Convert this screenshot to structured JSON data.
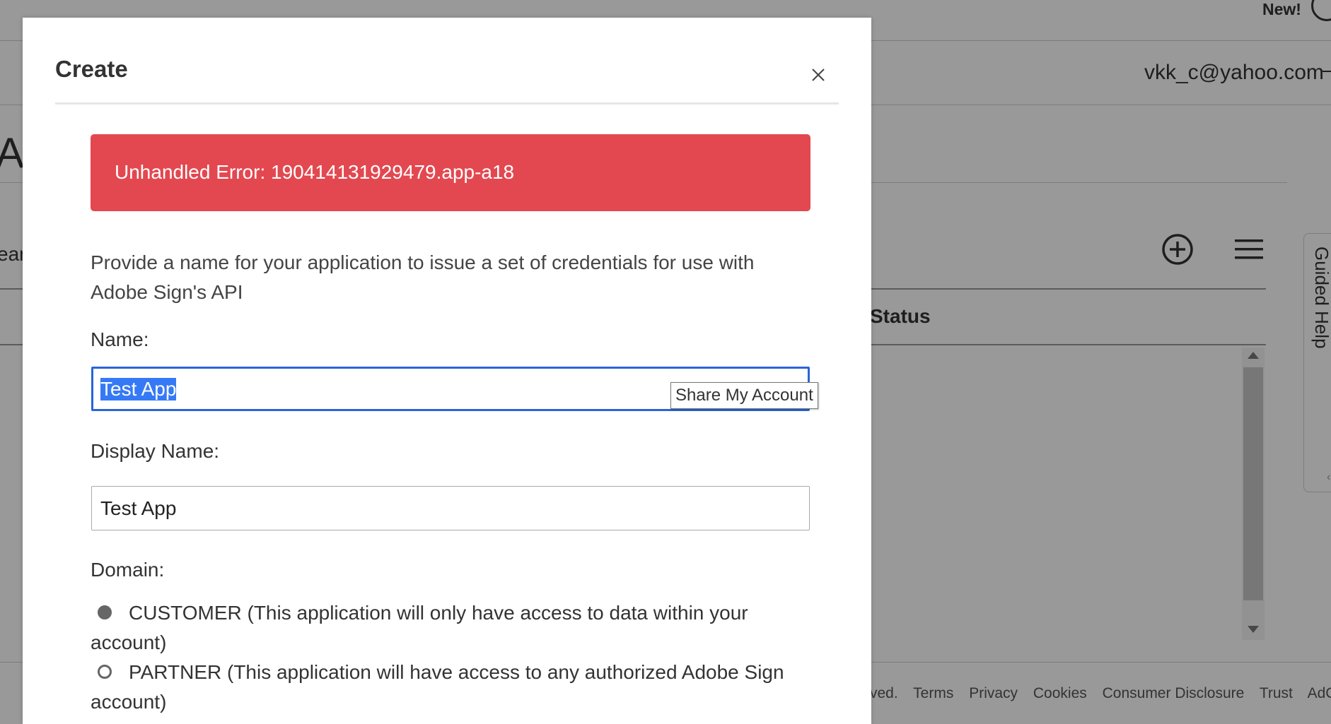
{
  "background": {
    "new_label": "New!",
    "user_email": "vkk_c@yahoo.com",
    "page_title_fragment": "Ap",
    "search_fragment": "ear",
    "table_status_header": "Status",
    "guided_help_label": "Guided Help",
    "footer": {
      "rights_fragment": "ved.",
      "links": [
        "Terms",
        "Privacy",
        "Cookies",
        "Consumer Disclosure",
        "Trust",
        "AdChoic"
      ]
    },
    "icons": [
      "plus-circle-icon",
      "hamburger-menu-icon",
      "help-icon",
      "chevron-down-icon"
    ]
  },
  "modal": {
    "title": "Create",
    "close_icon": "close-icon",
    "error_message": "Unhandled Error: 190414131929479.app-a18",
    "error_color": "#e34850",
    "description": "Provide a name for your application to issue a set of credentials for use with Adobe Sign's API",
    "name_label": "Name:",
    "name_value": "Test App",
    "autofill_tooltip": "Share My Account",
    "display_name_label": "Display Name:",
    "display_name_value": "Test App",
    "domain_label": "Domain:",
    "domain_options": [
      {
        "label": "CUSTOMER (This application will only have access to data within your account)",
        "selected": true
      },
      {
        "label": "PARTNER (This application will have access to any authorized Adobe Sign account)",
        "selected": false
      }
    ],
    "focus_color": "#2a64d8"
  }
}
